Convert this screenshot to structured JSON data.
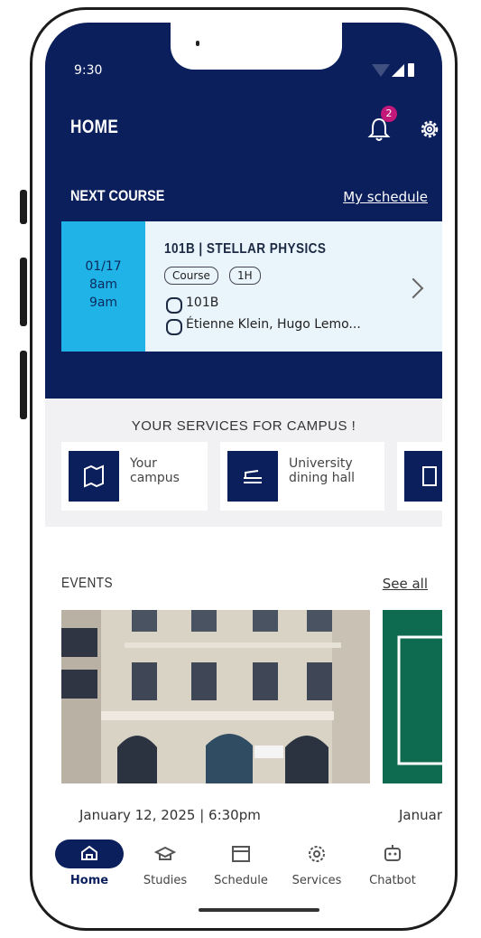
{
  "status_bar": {
    "time": "9:30"
  },
  "header": {
    "title": "HOME",
    "notification_count": "2"
  },
  "next_course": {
    "section_label": "NEXT COURSE",
    "link_label": "My schedule",
    "date": "01/17",
    "start": "8am",
    "end": "9am",
    "title": "101B | STELLAR PHYSICS",
    "tags": [
      "Course",
      "1H"
    ],
    "room": "101B",
    "teachers": "Étienne Klein, Hugo Lemo..."
  },
  "services": {
    "title": "YOUR SERVICES FOR CAMPUS !",
    "items": [
      {
        "line1": "Your",
        "line2": "campus"
      },
      {
        "line1": "University",
        "line2": "dining hall"
      }
    ]
  },
  "events": {
    "section_label": "EVENTS",
    "link_label": "See all",
    "items": [
      {
        "date": "January 12, 2025 | 6:30pm"
      },
      {
        "date": "January"
      }
    ]
  },
  "nav": {
    "items": [
      {
        "label": "Home"
      },
      {
        "label": "Studies"
      },
      {
        "label": "Schedule"
      },
      {
        "label": "Services"
      },
      {
        "label": "Chatbot"
      }
    ]
  },
  "colors": {
    "primary": "#0b1f5c",
    "accent": "#20b3e8",
    "badge": "#c2187a"
  }
}
